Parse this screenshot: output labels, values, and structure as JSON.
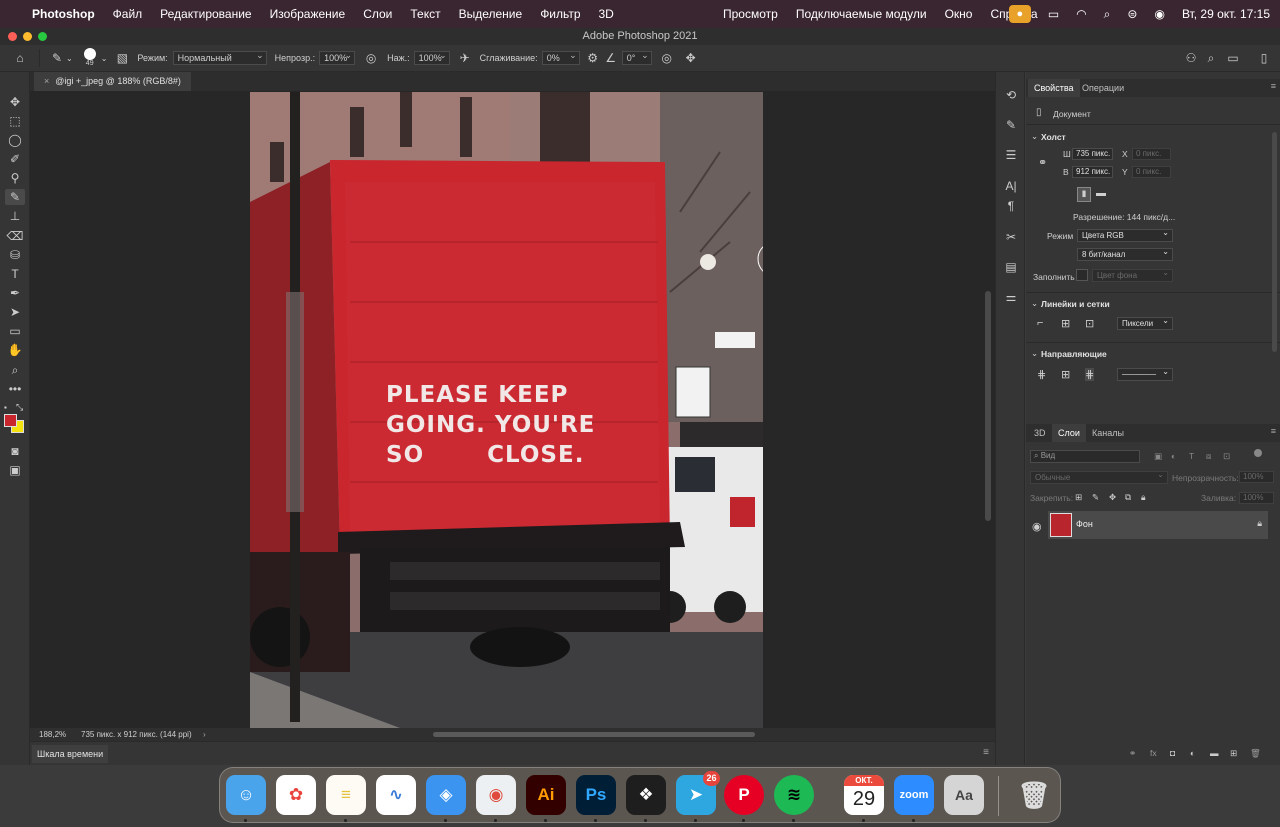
{
  "menubar": {
    "app_name": "Photoshop",
    "items": [
      "Файл",
      "Редактирование",
      "Изображение",
      "Слои",
      "Текст",
      "Выделение",
      "Фильтр",
      "3D"
    ],
    "right_items": [
      "Просмотр",
      "Подключаемые модули",
      "Окно",
      "Справка"
    ],
    "datetime": "Вт, 29 окт.  17:15"
  },
  "window": {
    "title": "Adobe Photoshop 2021"
  },
  "options": {
    "brush_size": "49",
    "mode_label": "Режим:",
    "mode_value": "Нормальный",
    "opacity_label": "Непрозр.:",
    "opacity_value": "100%",
    "pressure_label": "Наж.:",
    "pressure_value": "100%",
    "smoothing_label": "Сглаживание:",
    "smoothing_value": "0%",
    "angle_value": "0°"
  },
  "document": {
    "tab_title": "@igi +_jpeg @ 188% (RGB/8#)",
    "zoom": "188,2%",
    "info": "735 пикс. x 912 пикс. (144 ppi)",
    "timeline_label": "Шкала времени"
  },
  "canvas_text": {
    "line1": "PLEASE  KEEP",
    "line2": "GOING. YOU'RE",
    "line3": "SO       CLOSE."
  },
  "properties": {
    "tabs": [
      "Свойства",
      "Операции"
    ],
    "doc_label": "Документ",
    "canvas_section": "Холст",
    "w_label": "Ш",
    "w_value": "735 пикс.",
    "h_label": "В",
    "h_value": "912 пикс.",
    "x_label": "X",
    "x_placeholder": "0 пикс.",
    "y_label": "Y",
    "y_placeholder": "0 пикс.",
    "resolution": "Разрешение: 144 пикс/д...",
    "mode_label": "Режим",
    "mode_value": "Цвета RGB",
    "depth_value": "8 бит/канал",
    "fill_label": "Заполнить",
    "fill_value": "Цвет фона",
    "rulers_section": "Линейки и сетки",
    "units_value": "Пиксели",
    "guides_section": "Направляющие"
  },
  "layers": {
    "tabs": [
      "3D",
      "Слои",
      "Каналы"
    ],
    "search_placeholder": "Вид",
    "blend_value": "Обычные",
    "opacity_label": "Непрозрачность:",
    "opacity_value": "100%",
    "lock_label": "Закрепить:",
    "fill_label": "Заливка:",
    "fill_value": "100%",
    "layer_name": "Фон"
  },
  "dock": {
    "apps": [
      "finder-app",
      "photos-app",
      "notes-app",
      "freeform-app",
      "safari-app",
      "chrome-app",
      "illustrator-app",
      "photoshop-app",
      "figma-app",
      "telegram-app",
      "pinterest-app",
      "spotify-app",
      "calendar-app",
      "zoom-app",
      "fontbook-app",
      "trash"
    ],
    "ai_label": "Ai",
    "ps_label": "Ps",
    "telegram_badge": "26",
    "calendar_month": "ОКТ.",
    "calendar_day": "29",
    "zoom_label": "zoom"
  }
}
